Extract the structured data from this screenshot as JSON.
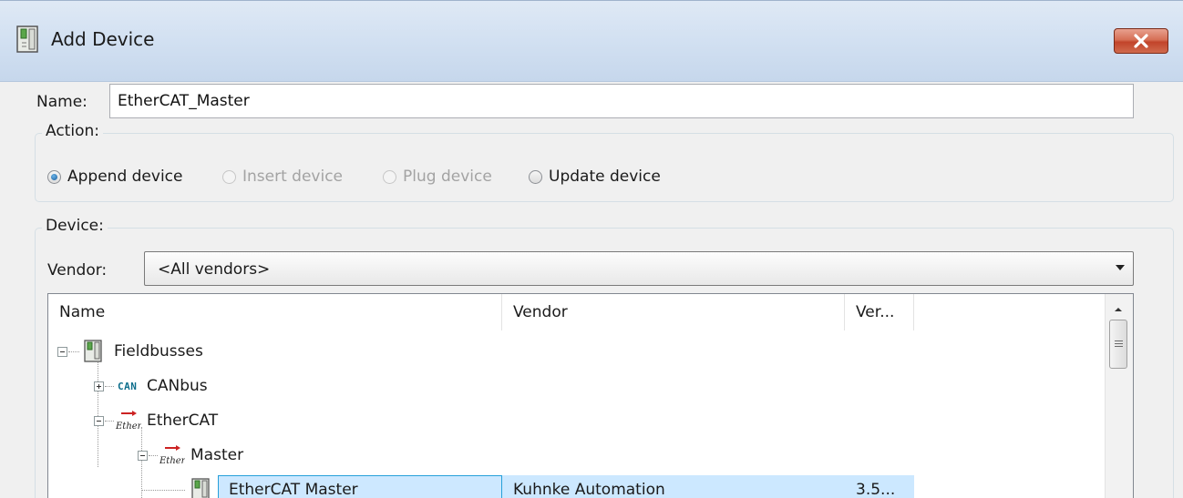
{
  "window": {
    "title": "Add Device"
  },
  "name_field": {
    "label": "Name:",
    "value": "EtherCAT_Master"
  },
  "action": {
    "legend": "Action:",
    "options": [
      {
        "label": "Append device",
        "checked": true,
        "enabled": true
      },
      {
        "label": "Insert device",
        "checked": false,
        "enabled": false
      },
      {
        "label": "Plug device",
        "checked": false,
        "enabled": false
      },
      {
        "label": "Update device",
        "checked": false,
        "enabled": true
      }
    ]
  },
  "device": {
    "legend": "Device:",
    "vendor_label": "Vendor:",
    "vendor_selected": "<All vendors>",
    "columns": [
      "Name",
      "Vendor",
      "Ver..."
    ],
    "tree": [
      {
        "label": "Fieldbusses",
        "icon": "device-icon",
        "expanded": true
      },
      {
        "label": "CANbus",
        "icon": "can-icon",
        "expanded": false
      },
      {
        "label": "EtherCAT",
        "icon": "ethercat-icon",
        "expanded": true
      },
      {
        "label": "Master",
        "icon": "ethercat-icon",
        "expanded": true
      },
      {
        "label": "EtherCAT Master",
        "icon": "device-icon",
        "vendor": "Kuhnke Automation",
        "version": "3.5...",
        "selected": true
      }
    ],
    "can_icon_text": "CAN"
  },
  "colors": {
    "selection": "#cce8ff",
    "selection_border": "#26a0da",
    "close_button": "#c2442a",
    "title_gradient": "#d3e1f2"
  }
}
